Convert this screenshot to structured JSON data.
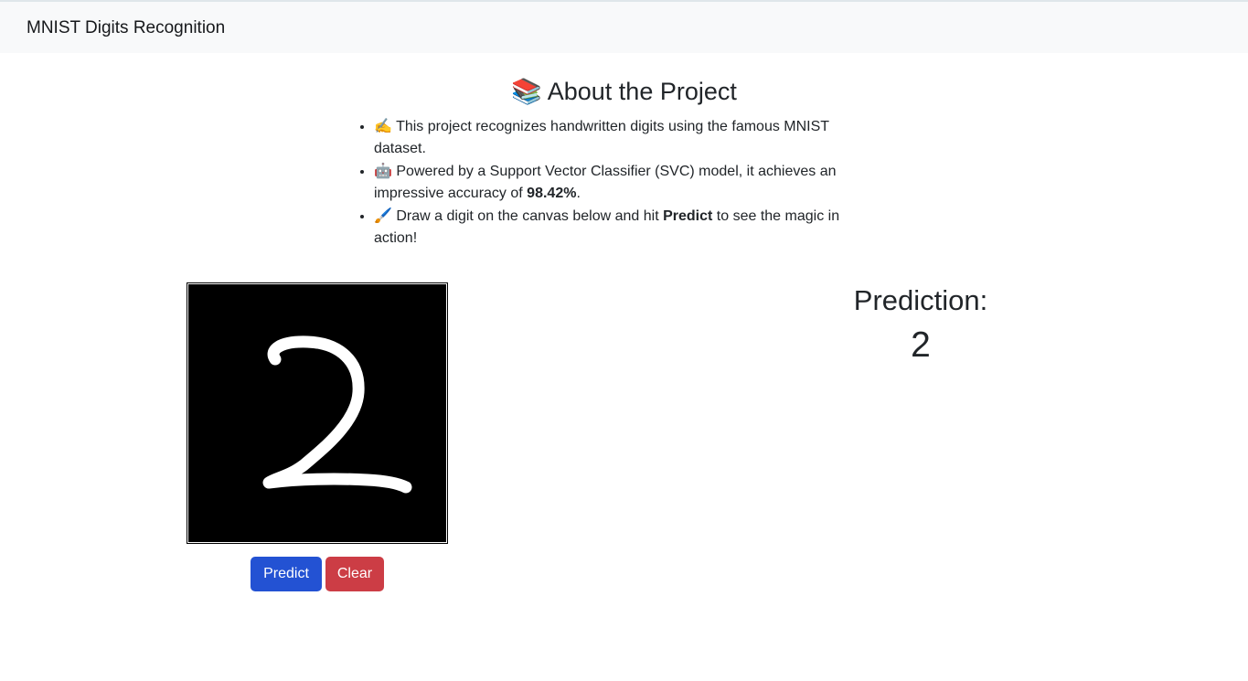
{
  "navbar": {
    "brand": "MNIST Digits Recognition"
  },
  "about": {
    "title_icon": "📚",
    "title": "About the Project",
    "items": [
      {
        "icon": "✍️",
        "text_before": "This project recognizes handwritten digits using the famous MNIST dataset.",
        "bold": "",
        "text_after": ""
      },
      {
        "icon": "🤖",
        "text_before": "Powered by a Support Vector Classifier (SVC) model, it achieves an impressive accuracy of ",
        "bold": "98.42%",
        "text_after": "."
      },
      {
        "icon": "🖌️",
        "text_before": "Draw a digit on the canvas below and hit ",
        "bold": "Predict",
        "text_after": " to see the magic in action!"
      }
    ]
  },
  "canvas": {
    "drawn_digit": "2",
    "background": "#000000",
    "stroke": "#ffffff"
  },
  "buttons": {
    "predict": "Predict",
    "clear": "Clear"
  },
  "prediction": {
    "label": "Prediction:",
    "value": "2"
  },
  "colors": {
    "predict": "#2352d3",
    "clear": "#cc3d45",
    "navbar": "#f8f9fa"
  }
}
